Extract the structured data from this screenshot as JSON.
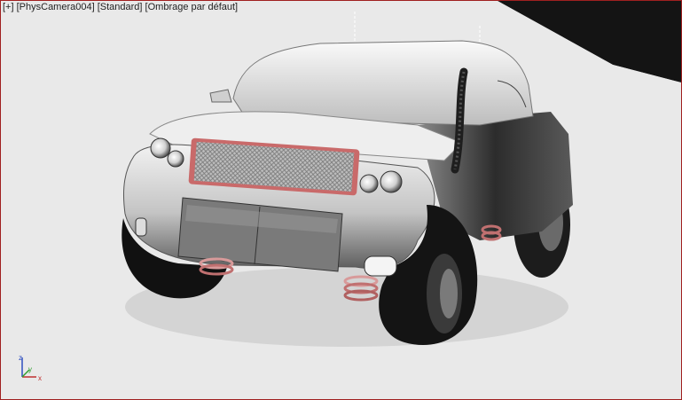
{
  "viewport": {
    "labels": {
      "menu": "[+]",
      "camera": "[PhysCamera004]",
      "shading_preset": "[Standard]",
      "shading_mode": "[Ombrage par défaut]"
    },
    "gizmo": {
      "x": "x",
      "y": "y",
      "z": "z"
    },
    "colors": {
      "border": "#a02020",
      "ground": "#e8e8e8",
      "sky": "#141414",
      "car_body": "#cfcfcf",
      "grille_frame": "#c96a6a",
      "axis_x": "#c03030",
      "axis_y": "#30a030",
      "axis_z": "#3050c0"
    }
  }
}
